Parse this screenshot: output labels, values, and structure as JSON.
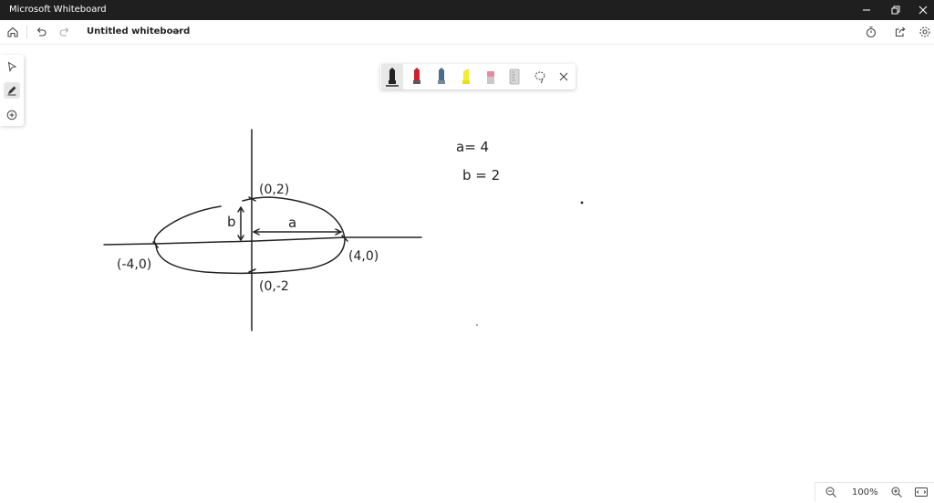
{
  "window": {
    "title": "Microsoft Whiteboard"
  },
  "toolbar": {
    "board_title": "Untitled whiteboard"
  },
  "pen_palette": {
    "colors": [
      "#222222",
      "#d0202a",
      "#4a6c86",
      "#f4ec2a",
      "#e58aa0",
      "#bdbdbd"
    ]
  },
  "canvas": {
    "labels": {
      "top_point": "(0,2)",
      "bottom_point": "(0,-2",
      "left_point": "(-4,0)",
      "right_point": "(4,0)",
      "semi_minor": "b",
      "semi_major": "a",
      "a_value": "a= 4",
      "b_value": "b = 2"
    }
  },
  "zoom": {
    "level": "100%"
  }
}
